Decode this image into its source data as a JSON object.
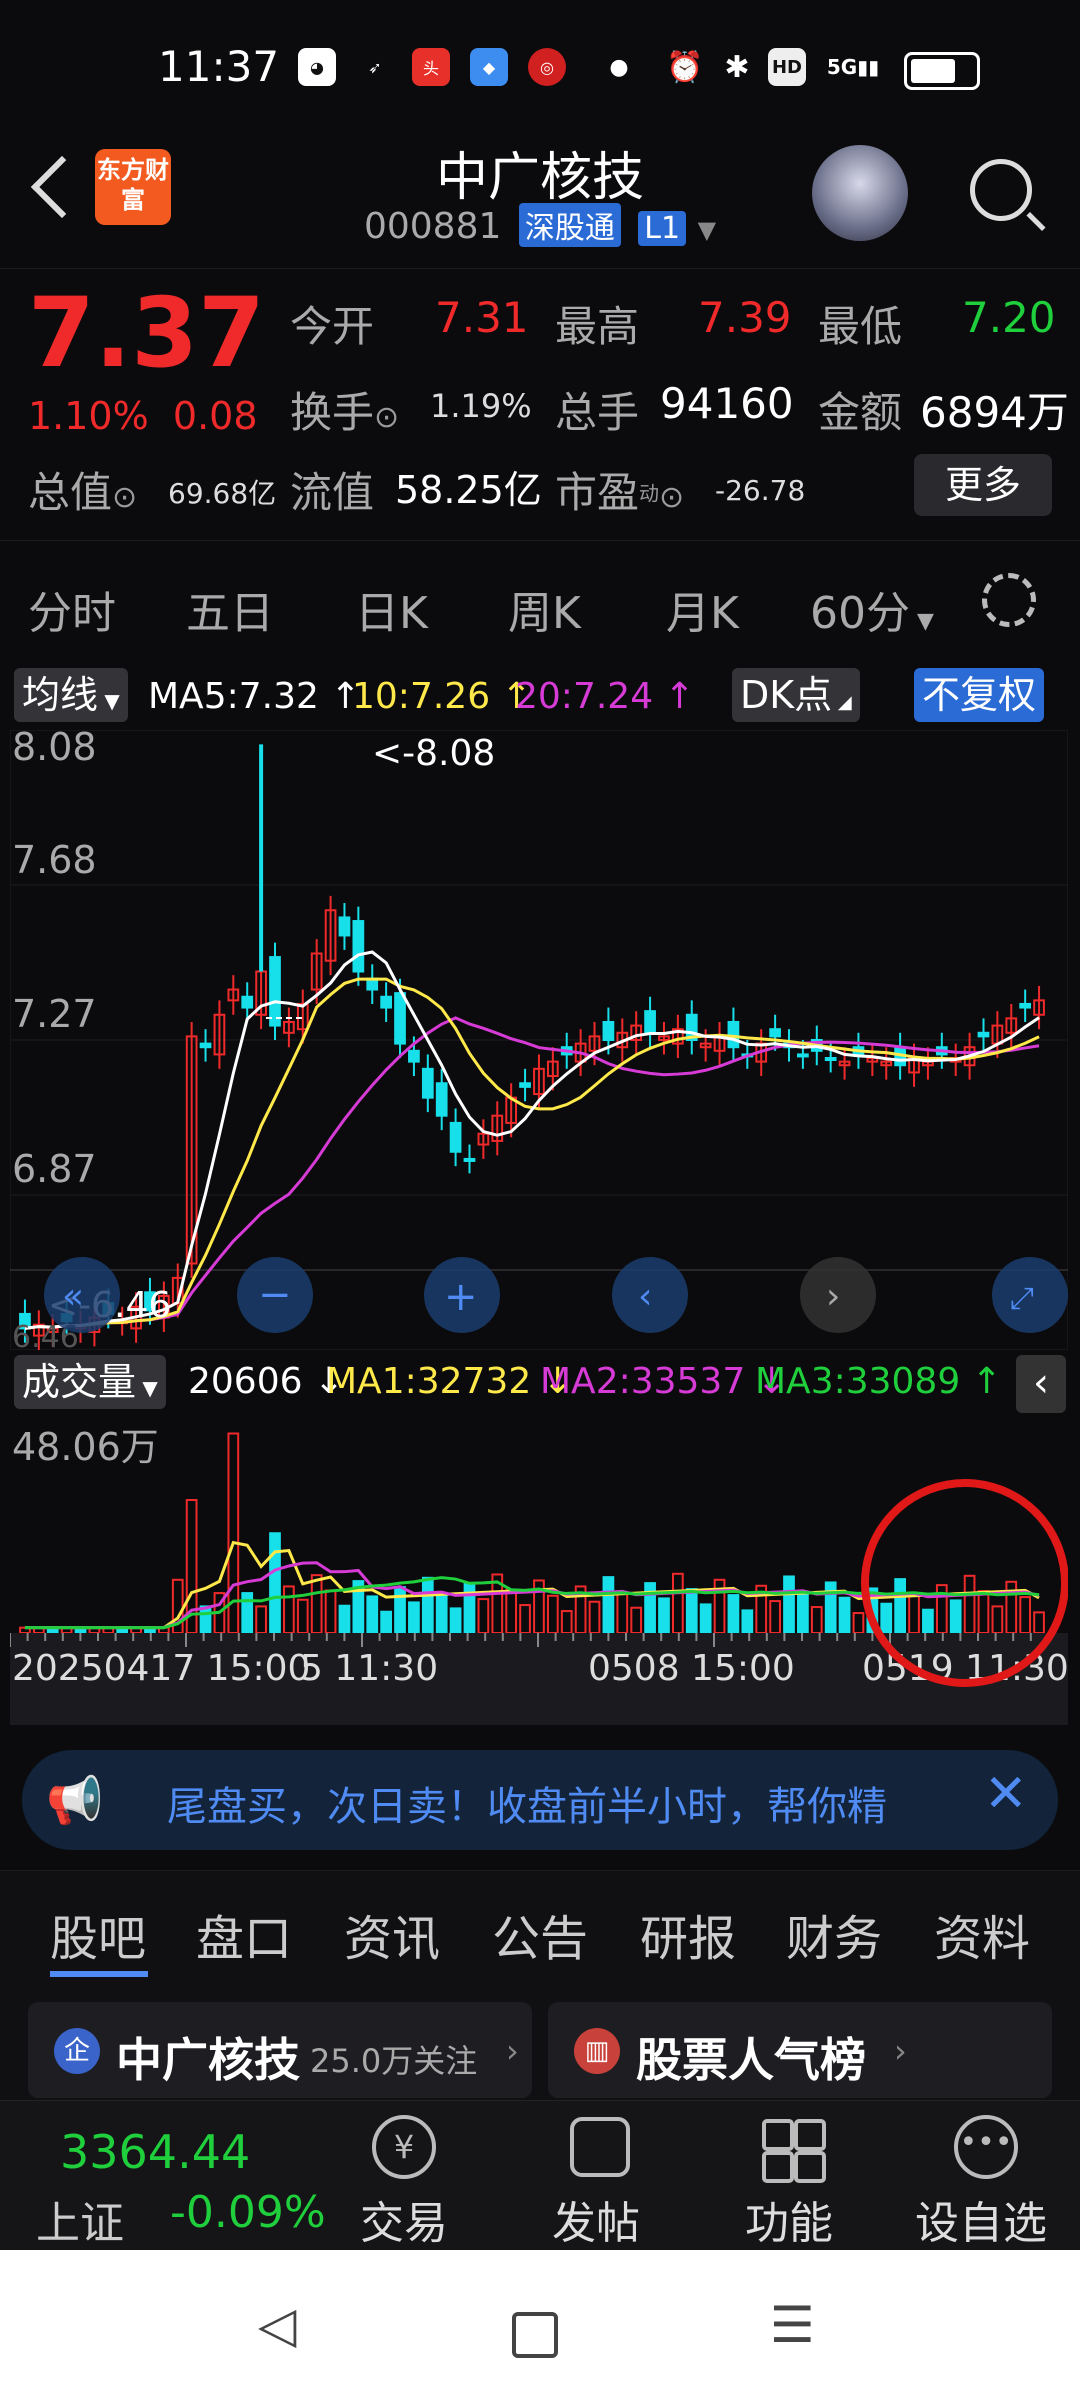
{
  "status": {
    "time": "11:37",
    "network": "5G"
  },
  "header": {
    "logo_text": "东方财富",
    "title": "中广核技",
    "code": "000881",
    "badge1": "深股通",
    "badge2": "L1"
  },
  "quote": {
    "price": "7.37",
    "pct": "1.10%",
    "change": "0.08",
    "open_label": "今开",
    "open": "7.31",
    "high_label": "最高",
    "high": "7.39",
    "low_label": "最低",
    "low": "7.20",
    "turnover_label": "换手",
    "turnover": "1.19%",
    "volume_label": "总手",
    "volume": "94160",
    "amount_label": "金额",
    "amount": "6894万",
    "mktcap_label": "总值",
    "mktcap": "69.68亿",
    "float_label": "流值",
    "float": "58.25亿",
    "pe_label": "市盈",
    "pe_sup": "动",
    "pe": "-26.78",
    "more": "更多"
  },
  "tabs": [
    "分时",
    "五日",
    "日K",
    "周K",
    "月K",
    "60分"
  ],
  "ma_row": {
    "selector": "均线",
    "ma5": "MA5:7.32 ↑",
    "ma10": "10:7.26 ↑",
    "ma20": "20:7.24 ↑",
    "dk": "DK点",
    "fq": "不复权"
  },
  "price_axis": [
    "8.08",
    "7.68",
    "7.27",
    "6.87"
  ],
  "markers": {
    "max": "<-8.08",
    "min": "<-6.46",
    "bottom_tick": "6.46"
  },
  "vol_row": {
    "selector": "成交量",
    "vol": "20606 ↓",
    "ma1": "MA1:32732 ↓",
    "ma2": "MA2:33537 ↓",
    "ma3": "MA3:33089 ↑"
  },
  "vol_axis": "48.06万",
  "time_axis": [
    "20250417 15:00",
    "5 11:30",
    "0508 15:00",
    "0519 11:30"
  ],
  "banner": "尾盘买，次日卖！收盘前半小时，帮你精",
  "subtabs": [
    "股吧",
    "盘口",
    "资讯",
    "公告",
    "研报",
    "财务",
    "资料"
  ],
  "cards": {
    "left_name": "中广核技",
    "left_follow": "25.0万关注",
    "right": "股票人气榜"
  },
  "index": {
    "value": "3364.44",
    "name": "上证",
    "pct": "-0.09%"
  },
  "nav": [
    "交易",
    "发帖",
    "功能",
    "设自选"
  ],
  "colors": {
    "up": "#f02a2a",
    "down": "#1fcf3c",
    "accent": "#4f8bf2",
    "ma5": "#ffffff",
    "ma10": "#ffe94a",
    "ma20": "#d63bd6",
    "vol_down": "#17e0ea"
  }
}
